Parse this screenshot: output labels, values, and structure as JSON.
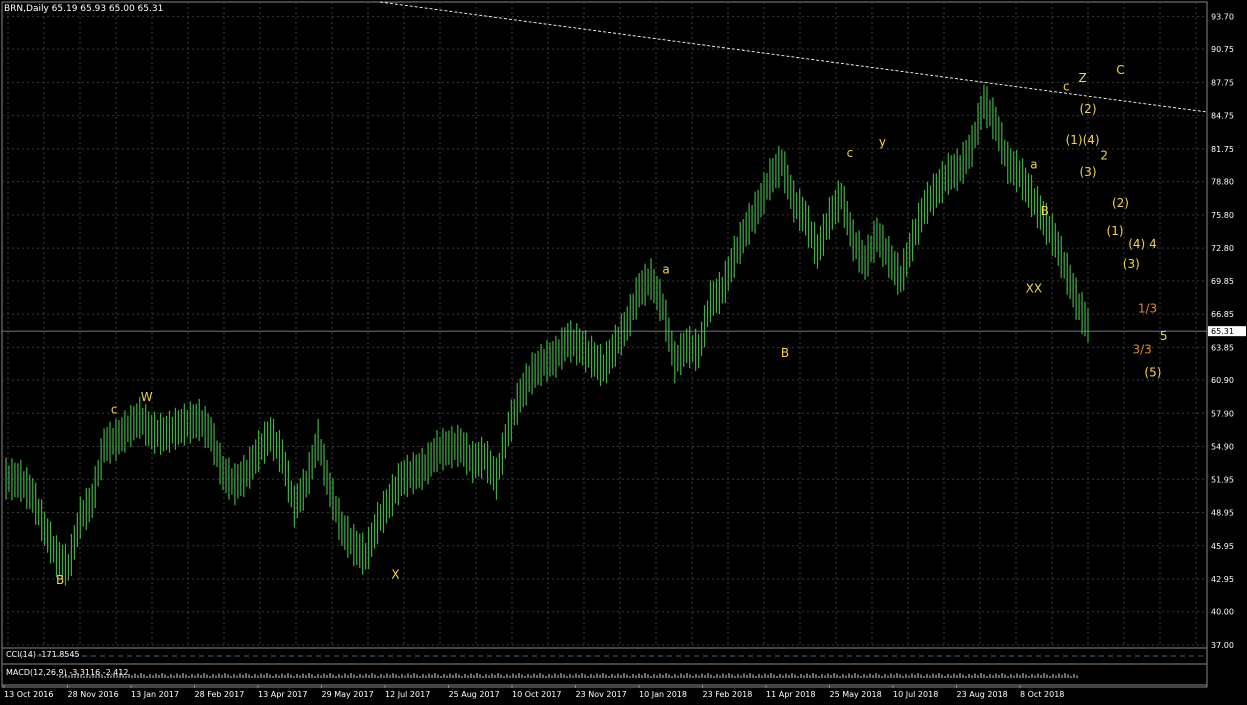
{
  "window": {
    "title": "BRN,Daily  65.19 65.93 65.00 65.31",
    "current_price": "65.31"
  },
  "indicators": {
    "cci_label": "CCI(14) -171.8545",
    "macd_label": "MACD(12,26,9) -3.3116 -2.412"
  },
  "colors": {
    "background": "#000000",
    "grid": "#3a3a3a",
    "candle": "#3cb043",
    "wave_label": "#f2d44a",
    "orange_label": "#e08a1e",
    "trend": "#ffffff"
  },
  "chart_data": {
    "type": "line",
    "title": "BRN,Daily",
    "xlabel": "",
    "ylabel": "",
    "ylim": [
      37.0,
      95.0
    ],
    "y_ticks": [
      "93.70",
      "90.75",
      "87.75",
      "84.75",
      "81.75",
      "78.80",
      "75.80",
      "72.80",
      "69.85",
      "66.85",
      "63.85",
      "60.90",
      "57.90",
      "54.90",
      "51.95",
      "48.95",
      "45.95",
      "42.95",
      "40.00",
      "37.00"
    ],
    "x_ticks": [
      "13 Oct 2016",
      "28 Nov 2016",
      "13 Jan 2017",
      "28 Feb 2017",
      "13 Apr 2017",
      "29 May 2017",
      "12 Jul 2017",
      "25 Aug 2017",
      "10 Oct 2017",
      "23 Nov 2017",
      "10 Jan 2018",
      "23 Feb 2018",
      "11 Apr 2018",
      "25 May 2018",
      "10 Jul 2018",
      "23 Aug 2018",
      "8 Oct 2018"
    ],
    "series": [
      {
        "values": [
          52.0,
          51.8,
          50.5,
          47.5,
          45.0,
          44.0,
          48.5,
          50.0,
          55.0,
          55.5,
          56.5,
          57.5,
          56.2,
          56.0,
          56.5,
          57.0,
          57.3,
          56.0,
          52.5,
          51.5,
          52.5,
          54.5,
          56.0,
          54.0,
          49.5,
          51.5,
          55.5,
          51.0,
          47.5,
          46.0,
          45.0,
          48.0,
          50.0,
          52.0,
          52.5,
          53.0,
          54.5,
          54.8,
          55.0,
          53.5,
          54.0,
          52.0,
          56.5,
          59.5,
          61.5,
          62.5,
          63.0,
          64.5,
          64.0,
          63.0,
          62.0,
          64.0,
          66.0,
          69.0,
          70.0,
          67.5,
          62.5,
          64.0,
          63.5,
          68.0,
          69.0,
          72.0,
          74.5,
          76.5,
          79.0,
          80.5,
          77.0,
          75.5,
          72.5,
          75.5,
          77.5,
          73.5,
          71.5,
          74.0,
          72.0,
          70.0,
          73.5,
          76.5,
          78.0,
          79.5,
          80.0,
          82.0,
          86.0,
          84.0,
          80.5,
          79.5,
          77.5,
          75.5,
          73.5,
          70.5,
          67.5,
          65.3
        ]
      }
    ],
    "annotations": [
      {
        "text": "B",
        "x": 0.05,
        "y": 42.5
      },
      {
        "text": "c",
        "x": 0.1,
        "y": 57.9
      },
      {
        "text": "W",
        "x": 0.13,
        "y": 59.0
      },
      {
        "text": "X",
        "x": 0.36,
        "y": 43.0
      },
      {
        "text": "a",
        "x": 0.61,
        "y": 70.5
      },
      {
        "text": "B",
        "x": 0.72,
        "y": 63.0
      },
      {
        "text": "c",
        "x": 0.78,
        "y": 81.0
      },
      {
        "text": "y",
        "x": 0.81,
        "y": 82.0
      },
      {
        "text": "XX",
        "x": 0.95,
        "y": 68.8
      },
      {
        "text": "a",
        "x": 0.95,
        "y": 80.0
      },
      {
        "text": "B",
        "x": 0.96,
        "y": 75.8
      },
      {
        "text": "c",
        "x": 0.98,
        "y": 87.0
      },
      {
        "text": "Z",
        "x": 0.995,
        "y": 87.8
      },
      {
        "text": "C",
        "x": 1.03,
        "y": 88.5
      },
      {
        "text": "(2)",
        "x": 1.0,
        "y": 85.0
      },
      {
        "text": "(1)(4)",
        "x": 0.995,
        "y": 82.2
      },
      {
        "text": "2",
        "x": 1.015,
        "y": 80.8
      },
      {
        "text": "(3)",
        "x": 1.0,
        "y": 79.3
      },
      {
        "text": "(2)",
        "x": 1.03,
        "y": 76.5
      },
      {
        "text": "(1)",
        "x": 1.025,
        "y": 74.0
      },
      {
        "text": "(4)",
        "x": 1.045,
        "y": 72.8
      },
      {
        "text": "4",
        "x": 1.06,
        "y": 72.8
      },
      {
        "text": "(3)",
        "x": 1.04,
        "y": 71.0
      },
      {
        "text": "1/3",
        "x": 1.055,
        "y": 67.0
      },
      {
        "text": "5",
        "x": 1.07,
        "y": 64.5
      },
      {
        "text": "3/3",
        "x": 1.05,
        "y": 63.3
      },
      {
        "text": "(5)",
        "x": 1.06,
        "y": 61.2
      }
    ]
  }
}
